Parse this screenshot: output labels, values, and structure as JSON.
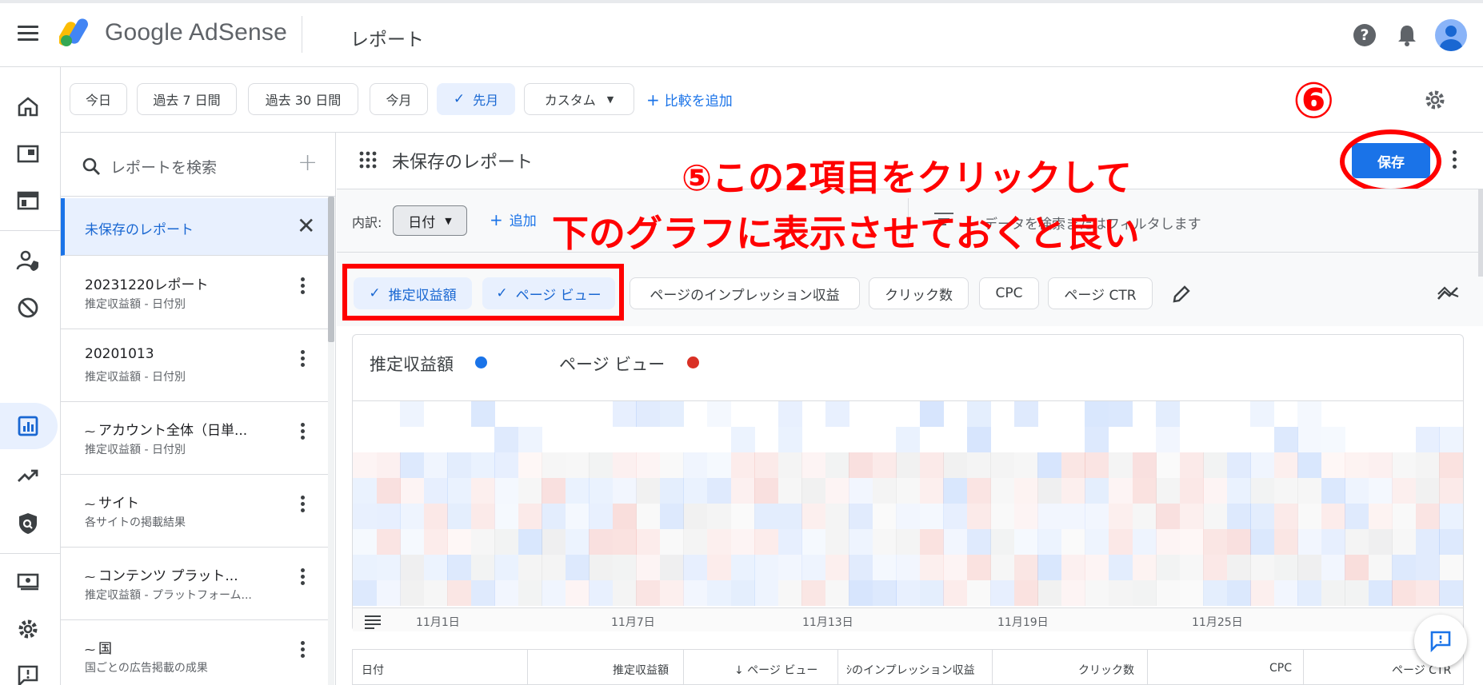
{
  "header": {
    "brand": "Google AdSense",
    "page_title": "レポート",
    "help_glyph": "?"
  },
  "date_filters": {
    "chips": [
      "今日",
      "過去 7 日間",
      "過去 30 日間",
      "今月",
      "先月",
      "カスタム"
    ],
    "selected": "先月",
    "add_comparison": "比較を追加"
  },
  "sidebar": {
    "search_placeholder": "レポートを検索",
    "items": [
      {
        "title": "未保存のレポート",
        "subtitle": "",
        "selected": true
      },
      {
        "title": "20231220レポート",
        "subtitle": "推定収益額 - 日付別"
      },
      {
        "title": "20201013",
        "subtitle": "推定収益額 - 日付別"
      },
      {
        "title": "アカウント全体（日単...",
        "subtitle": "推定収益額 - 日付別",
        "icon": "sparkle-icon"
      },
      {
        "title": "サイト",
        "subtitle": "各サイトの掲載結果",
        "icon": "sparkle-icon"
      },
      {
        "title": "コンテンツ プラット...",
        "subtitle": "推定収益額 - プラットフォーム...",
        "icon": "sparkle-icon"
      },
      {
        "title": "国",
        "subtitle": "国ごとの広告掲載の成果",
        "icon": "sparkle-icon"
      }
    ]
  },
  "report": {
    "title": "未保存のレポート",
    "save_label": "保存",
    "breakdown_label": "内訳:",
    "breakdown_value": "日付",
    "add_label": "追加",
    "filter_placeholder": "データを検索またはフィルタします"
  },
  "metrics": {
    "chips": [
      {
        "label": "推定収益額",
        "selected": true
      },
      {
        "label": "ページ ビュー",
        "selected": true
      },
      {
        "label": "ページのインプレッション収益",
        "selected": false
      },
      {
        "label": "クリック数",
        "selected": false
      },
      {
        "label": "CPC",
        "selected": false
      },
      {
        "label": "ページ CTR",
        "selected": false
      }
    ]
  },
  "chart": {
    "legend": [
      {
        "name": "推定収益額",
        "color": "#1a73e8"
      },
      {
        "name": "ページ ビュー",
        "color": "#d93025"
      }
    ],
    "x_ticks": [
      "11月1日",
      "11月7日",
      "11月13日",
      "11月19日",
      "11月25日"
    ]
  },
  "table": {
    "columns": [
      "日付",
      "推定収益額",
      "↓ ページ ビュー",
      "ｼのインプレッション収益",
      "クリック数",
      "CPC",
      "ページ CTR"
    ]
  },
  "annotations": {
    "step6": "⑥",
    "step5_line1": "⑤この2項目をクリックして",
    "step5_line2": "下のグラフに表示させておくと良い"
  },
  "colors": {
    "accent": "#1a73e8",
    "annotation": "#ff0000",
    "selected_chip_bg": "#e8f0fe"
  }
}
